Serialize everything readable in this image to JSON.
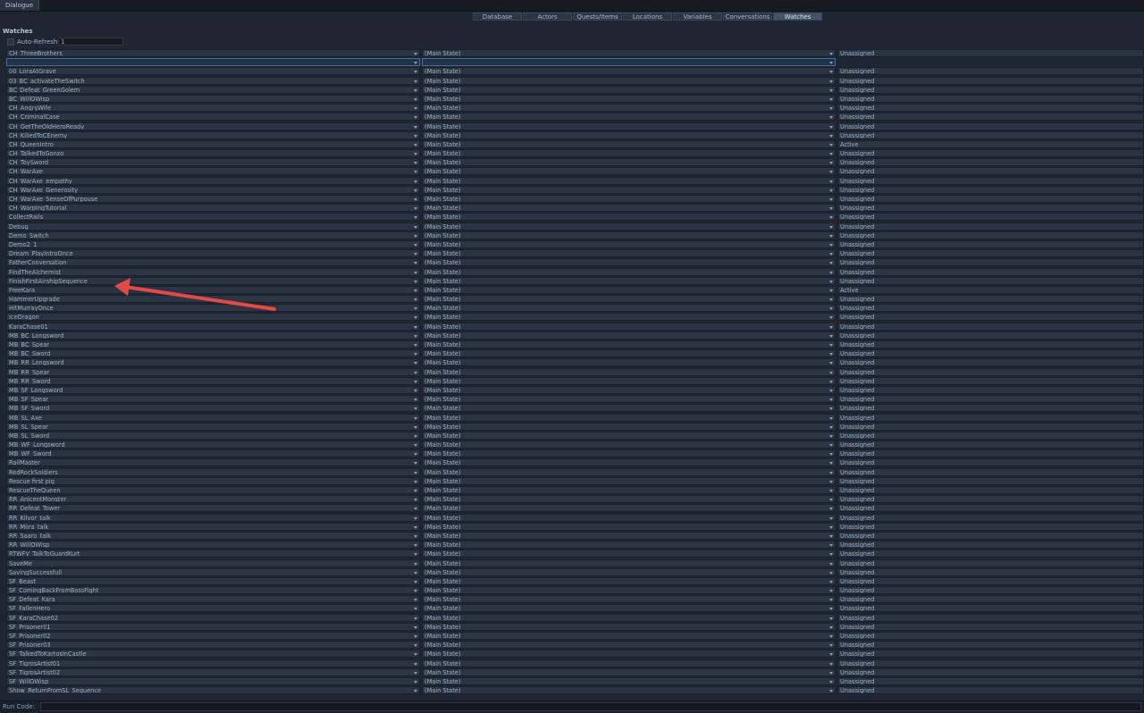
{
  "window": {
    "tab_label": "Dialogue"
  },
  "tabs": [
    {
      "label": "Database",
      "active": false
    },
    {
      "label": "Actors",
      "active": false
    },
    {
      "label": "Quests/Items",
      "active": false
    },
    {
      "label": "Locations",
      "active": false
    },
    {
      "label": "Variables",
      "active": false
    },
    {
      "label": "Conversations",
      "active": false
    },
    {
      "label": "Watches",
      "active": true
    }
  ],
  "section_title": "Watches",
  "auto_refresh": {
    "label": "Auto-Refresh",
    "value": "1"
  },
  "watch_rows": [
    {
      "quest": "CH_ThreeBrothers",
      "entry": "(Main State)",
      "status": "Unassigned"
    },
    {
      "quest": "",
      "entry": "",
      "status": ""
    },
    {
      "quest": "00_LoraAtGrave",
      "entry": "(Main State)",
      "status": "Unassigned"
    },
    {
      "quest": "03_BC_activateTheSwitch",
      "entry": "(Main State)",
      "status": "Unassigned"
    },
    {
      "quest": "BC_Defeat_GreenGolem",
      "entry": "(Main State)",
      "status": "Unassigned"
    },
    {
      "quest": "BC_WillOWisp",
      "entry": "(Main State)",
      "status": "Unassigned"
    },
    {
      "quest": "CH_AngryWife",
      "entry": "(Main State)",
      "status": "Unassigned"
    },
    {
      "quest": "CH_CriminalCase",
      "entry": "(Main State)",
      "status": "Unassigned"
    },
    {
      "quest": "CH_GetTheOldHeroReady",
      "entry": "(Main State)",
      "status": "Unassigned"
    },
    {
      "quest": "CH_KilledToCEnemy",
      "entry": "(Main State)",
      "status": "Unassigned"
    },
    {
      "quest": "CH_QueenIntro",
      "entry": "(Main State)",
      "status": "Active"
    },
    {
      "quest": "CH_TalkedToGonzo",
      "entry": "(Main State)",
      "status": "Unassigned"
    },
    {
      "quest": "CH_ToySword",
      "entry": "(Main State)",
      "status": "Unassigned"
    },
    {
      "quest": "CH_WarAxe",
      "entry": "(Main State)",
      "status": "Unassigned"
    },
    {
      "quest": "CH_WarAxe_empathy",
      "entry": "(Main State)",
      "status": "Unassigned"
    },
    {
      "quest": "CH_WarAxe_Generosity",
      "entry": "(Main State)",
      "status": "Unassigned"
    },
    {
      "quest": "CH_WarAxe_SenseOfPurpouse",
      "entry": "(Main State)",
      "status": "Unassigned"
    },
    {
      "quest": "CH_WarpingTutorial",
      "entry": "(Main State)",
      "status": "Unassigned"
    },
    {
      "quest": "CollectRails",
      "entry": "(Main State)",
      "status": "Unassigned"
    },
    {
      "quest": "Debug",
      "entry": "(Main State)",
      "status": "Unassigned"
    },
    {
      "quest": "Demo_Switch",
      "entry": "(Main State)",
      "status": "Unassigned"
    },
    {
      "quest": "Demo2_1",
      "entry": "(Main State)",
      "status": "Unassigned"
    },
    {
      "quest": "Dream_PlayIntroOnce",
      "entry": "(Main State)",
      "status": "Unassigned"
    },
    {
      "quest": "FatherConversation",
      "entry": "(Main State)",
      "status": "Unassigned"
    },
    {
      "quest": "FindTheAlchemist",
      "entry": "(Main State)",
      "status": "Unassigned"
    },
    {
      "quest": "FinishFirstAirshipSequence",
      "entry": "(Main State)",
      "status": "Unassigned"
    },
    {
      "quest": "FreeKara",
      "entry": "(Main State)",
      "status": "Active"
    },
    {
      "quest": "HammerUpgrade",
      "entry": "(Main State)",
      "status": "Unassigned"
    },
    {
      "quest": "HitMurrayOnce",
      "entry": "(Main State)",
      "status": "Unassigned"
    },
    {
      "quest": "IceDragon",
      "entry": "(Main State)",
      "status": "Unassigned"
    },
    {
      "quest": "KaraChase01",
      "entry": "(Main State)",
      "status": "Unassigned"
    },
    {
      "quest": "MB_BC_Longsword",
      "entry": "(Main State)",
      "status": "Unassigned"
    },
    {
      "quest": "MB_BC_Spear",
      "entry": "(Main State)",
      "status": "Unassigned"
    },
    {
      "quest": "MB_BC_Sword",
      "entry": "(Main State)",
      "status": "Unassigned"
    },
    {
      "quest": "MB_RR_Longsword",
      "entry": "(Main State)",
      "status": "Unassigned"
    },
    {
      "quest": "MB_RR_Spear",
      "entry": "(Main State)",
      "status": "Unassigned"
    },
    {
      "quest": "MB_RR_Sword",
      "entry": "(Main State)",
      "status": "Unassigned"
    },
    {
      "quest": "MB_SF_Longsword",
      "entry": "(Main State)",
      "status": "Unassigned"
    },
    {
      "quest": "MB_SF_Spear",
      "entry": "(Main State)",
      "status": "Unassigned"
    },
    {
      "quest": "MB_SF_Sword",
      "entry": "(Main State)",
      "status": "Unassigned"
    },
    {
      "quest": "MB_SL_Axe",
      "entry": "(Main State)",
      "status": "Unassigned"
    },
    {
      "quest": "MB_SL_Spear",
      "entry": "(Main State)",
      "status": "Unassigned"
    },
    {
      "quest": "MB_SL_Sword",
      "entry": "(Main State)",
      "status": "Unassigned"
    },
    {
      "quest": "MB_WF_Longsword",
      "entry": "(Main State)",
      "status": "Unassigned"
    },
    {
      "quest": "MB_WF_Sword",
      "entry": "(Main State)",
      "status": "Unassigned"
    },
    {
      "quest": "RailMaster",
      "entry": "(Main State)",
      "status": "Unassigned"
    },
    {
      "quest": "RedRockSoldiers",
      "entry": "(Main State)",
      "status": "Unassigned"
    },
    {
      "quest": "Rescue first pig",
      "entry": "(Main State)",
      "status": "Unassigned"
    },
    {
      "quest": "RescueTheQueen",
      "entry": "(Main State)",
      "status": "Unassigned"
    },
    {
      "quest": "RR_AnicentMonster",
      "entry": "(Main State)",
      "status": "Unassigned"
    },
    {
      "quest": "RR_Defeat_Tower",
      "entry": "(Main State)",
      "status": "Unassigned"
    },
    {
      "quest": "RR_Kilvor_talk",
      "entry": "(Main State)",
      "status": "Unassigned"
    },
    {
      "quest": "RR_Miira_talk",
      "entry": "(Main State)",
      "status": "Unassigned"
    },
    {
      "quest": "RR_Saaro_talk",
      "entry": "(Main State)",
      "status": "Unassigned"
    },
    {
      "quest": "RR_WillOWisp",
      "entry": "(Main State)",
      "status": "Unassigned"
    },
    {
      "quest": "RTWFV_TalkToGuardKurt",
      "entry": "(Main State)",
      "status": "Unassigned"
    },
    {
      "quest": "SaveMe",
      "entry": "(Main State)",
      "status": "Unassigned"
    },
    {
      "quest": "SavingSuccessfull",
      "entry": "(Main State)",
      "status": "Unassigned"
    },
    {
      "quest": "SF_Beast",
      "entry": "(Main State)",
      "status": "Unassigned"
    },
    {
      "quest": "SF_ComingBackFromBossFight",
      "entry": "(Main State)",
      "status": "Unassigned"
    },
    {
      "quest": "SF_Defeat_Kara",
      "entry": "(Main State)",
      "status": "Unassigned"
    },
    {
      "quest": "SF_FallenHero",
      "entry": "(Main State)",
      "status": "Unassigned"
    },
    {
      "quest": "SF_KaraChase02",
      "entry": "(Main State)",
      "status": "Unassigned"
    },
    {
      "quest": "SF_Prisoner01",
      "entry": "(Main State)",
      "status": "Unassigned"
    },
    {
      "quest": "SF_Prisoner02",
      "entry": "(Main State)",
      "status": "Unassigned"
    },
    {
      "quest": "SF_Prisoner03",
      "entry": "(Main State)",
      "status": "Unassigned"
    },
    {
      "quest": "SF_TalkedToKartosInCastle",
      "entry": "(Main State)",
      "status": "Unassigned"
    },
    {
      "quest": "SF_TigrosArtist01",
      "entry": "(Main State)",
      "status": "Unassigned"
    },
    {
      "quest": "SF_TigrosArtist02",
      "entry": "(Main State)",
      "status": "Unassigned"
    },
    {
      "quest": "SF_WillOWisp",
      "entry": "(Main State)",
      "status": "Unassigned"
    },
    {
      "quest": "Show_ReturnFromSL_Sequence",
      "entry": "(Main State)",
      "status": "Unassigned"
    }
  ],
  "run_code": {
    "label": "Run Code:",
    "value": ""
  },
  "colors": {
    "background": "#1f2631",
    "cell": "#2a3442",
    "accent": "#3d6ea8",
    "annotation_arrow": "#e24a4a"
  }
}
